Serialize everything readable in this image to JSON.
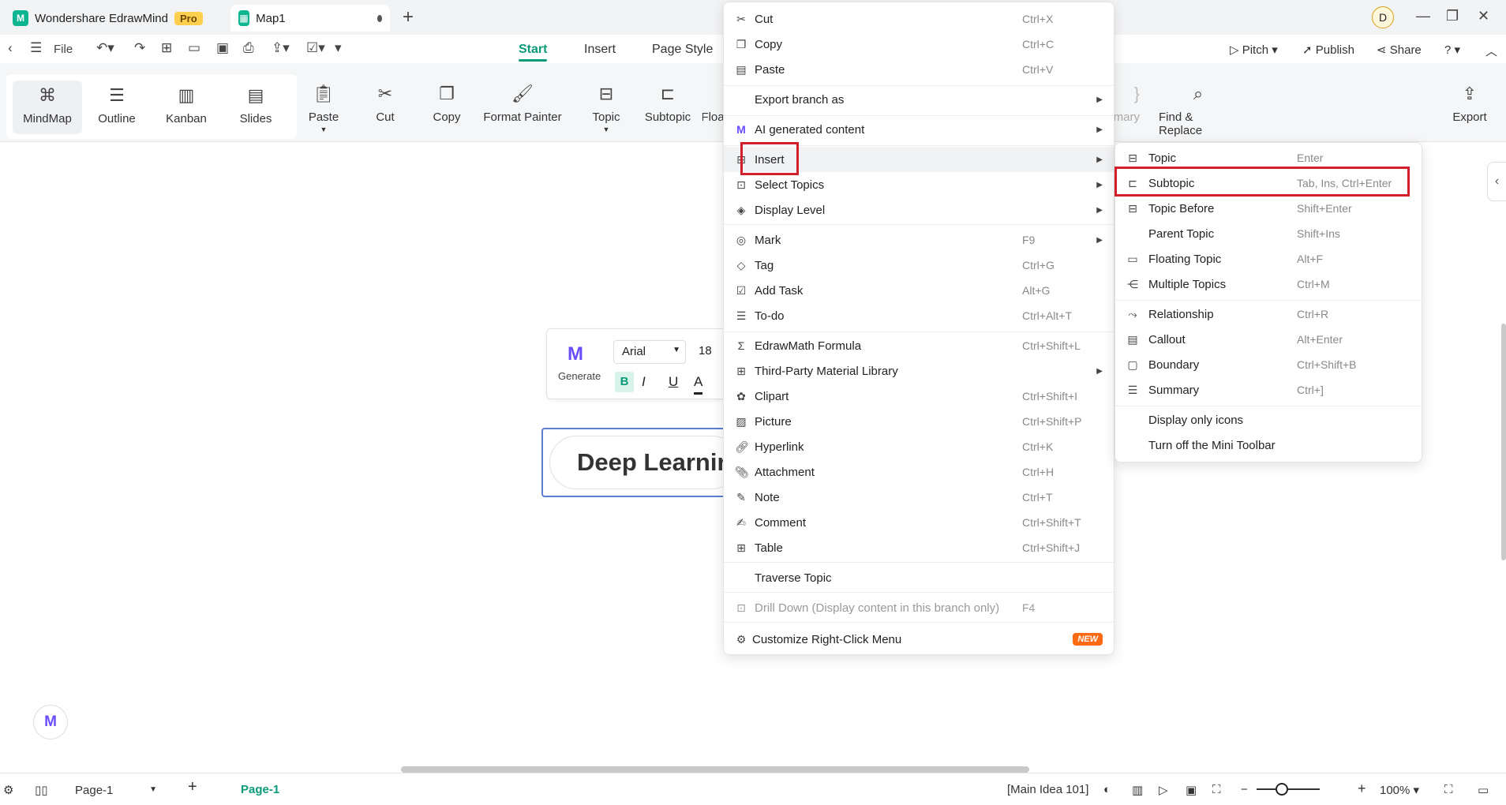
{
  "titlebar": {
    "app_name": "Wondershare EdrawMind",
    "pro_badge": "Pro",
    "doc_tab": "Map1",
    "avatar_letter": "D"
  },
  "menubar": {
    "file_label": "File",
    "tabs": [
      "Start",
      "Insert",
      "Page Style"
    ],
    "active_tab": "Start",
    "pitch_label": "Pitch",
    "publish_label": "Publish",
    "share_label": "Share"
  },
  "ribbon": {
    "views": [
      "MindMap",
      "Outline",
      "Kanban",
      "Slides"
    ],
    "selected_view": "MindMap",
    "tools": [
      "Paste",
      "Cut",
      "Copy",
      "Format Painter",
      "Topic",
      "Subtopic",
      "Floa"
    ],
    "partial_right": "mary",
    "find_replace": "Find & Replace",
    "export": "Export"
  },
  "mini_toolbar": {
    "generate_label": "Generate",
    "font": "Arial",
    "size": "18"
  },
  "canvas": {
    "topic_text": "Deep Learnin"
  },
  "context_menu": {
    "items": [
      {
        "label": "Cut",
        "shortcut": "Ctrl+X",
        "icon": "scissors-icon"
      },
      {
        "label": "Copy",
        "shortcut": "Ctrl+C",
        "icon": "copy-icon"
      },
      {
        "label": "Paste",
        "shortcut": "Ctrl+V",
        "icon": "paste-icon"
      },
      {
        "label": "Export branch as",
        "shortcut": "",
        "submenu": true
      },
      {
        "label": "AI generated content",
        "shortcut": "",
        "submenu": true
      },
      {
        "label": "Insert",
        "shortcut": "",
        "submenu": true
      },
      {
        "label": "Select Topics",
        "shortcut": "",
        "submenu": true
      },
      {
        "label": "Display Level",
        "shortcut": "",
        "submenu": true
      },
      {
        "label": "Mark",
        "shortcut": "F9",
        "submenu": true
      },
      {
        "label": "Tag",
        "shortcut": "Ctrl+G"
      },
      {
        "label": "Add Task",
        "shortcut": "Alt+G"
      },
      {
        "label": "To-do",
        "shortcut": "Ctrl+Alt+T"
      },
      {
        "label": "EdrawMath Formula",
        "shortcut": "Ctrl+Shift+L"
      },
      {
        "label": "Third-Party Material Library",
        "shortcut": "",
        "submenu": true
      },
      {
        "label": "Clipart",
        "shortcut": "Ctrl+Shift+I"
      },
      {
        "label": "Picture",
        "shortcut": "Ctrl+Shift+P"
      },
      {
        "label": "Hyperlink",
        "shortcut": "Ctrl+K"
      },
      {
        "label": "Attachment",
        "shortcut": "Ctrl+H"
      },
      {
        "label": "Note",
        "shortcut": "Ctrl+T"
      },
      {
        "label": "Comment",
        "shortcut": "Ctrl+Shift+T"
      },
      {
        "label": "Table",
        "shortcut": "Ctrl+Shift+J"
      },
      {
        "label": "Traverse Topic",
        "shortcut": ""
      },
      {
        "label": "Drill Down (Display content in this branch only)",
        "shortcut": "F4",
        "disabled": true
      },
      {
        "label": "Customize Right-Click Menu",
        "shortcut": "",
        "badge": "NEW"
      }
    ]
  },
  "insert_submenu": {
    "items": [
      {
        "label": "Topic",
        "shortcut": "Enter"
      },
      {
        "label": "Subtopic",
        "shortcut": "Tab, Ins, Ctrl+Enter"
      },
      {
        "label": "Topic Before",
        "shortcut": "Shift+Enter"
      },
      {
        "label": "Parent Topic",
        "shortcut": "Shift+Ins"
      },
      {
        "label": "Floating Topic",
        "shortcut": "Alt+F"
      },
      {
        "label": "Multiple Topics",
        "shortcut": "Ctrl+M"
      },
      {
        "label": "Relationship",
        "shortcut": "Ctrl+R"
      },
      {
        "label": "Callout",
        "shortcut": "Alt+Enter"
      },
      {
        "label": "Boundary",
        "shortcut": "Ctrl+Shift+B"
      },
      {
        "label": "Summary",
        "shortcut": "Ctrl+]"
      },
      {
        "label": "Display only icons",
        "shortcut": ""
      },
      {
        "label": "Turn off the Mini Toolbar",
        "shortcut": ""
      }
    ]
  },
  "statusbar": {
    "page_select": "Page-1",
    "page_tab": "Page-1",
    "main_idea": "[Main Idea 101]",
    "zoom": "100%"
  }
}
